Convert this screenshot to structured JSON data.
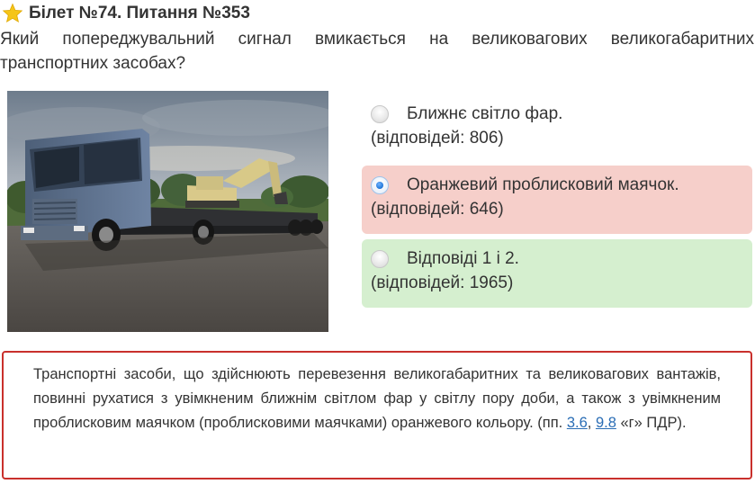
{
  "header": {
    "title": "Білет №74. Питання №353",
    "star_color": "#f5c518"
  },
  "question": {
    "text": "Який попереджувальний сигнал вмикається на великовагових великогабаритних транспортних засобах?"
  },
  "image": {
    "icon": "truck-with-excavator-photo"
  },
  "answers": [
    {
      "label": "Ближнє світло фар.",
      "count_text": "(відповідей: 806)",
      "selected": false,
      "state": "neutral"
    },
    {
      "label": "Оранжевий проблисковий маячок.",
      "count_text": "(відповідей: 646)",
      "selected": true,
      "state": "wrong"
    },
    {
      "label": "Відповіді 1 і 2.",
      "count_text": "(відповідей: 1965)",
      "selected": false,
      "state": "correct"
    }
  ],
  "colors": {
    "wrong_bg": "#f6cfca",
    "correct_bg": "#d5efcf",
    "explanation_border": "#c9302c",
    "link": "#2a6db5"
  },
  "explanation": {
    "text_before": "Транспортні засоби, що здійснюють перевезення великогабаритних та великовагових вантажів, повинні рухатися з увімкненим ближнім світлом фар у світлу пору доби, а також з увімкненим проблисковим маячком (проблисковими маячками) оранжевого кольору. (пп. ",
    "link1": "3.6",
    "separator": ", ",
    "link2": "9.8",
    "text_after": " «г» ПДР)."
  }
}
